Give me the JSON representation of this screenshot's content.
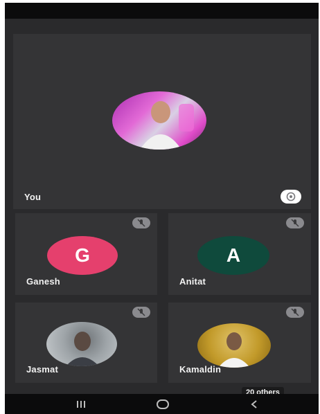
{
  "tiles": {
    "you": {
      "name": "You"
    },
    "p1": {
      "name": "Ganesh",
      "initial": "G"
    },
    "p2": {
      "name": "Anitat",
      "initial": "A"
    },
    "p3": {
      "name": "Jasmat"
    },
    "p4": {
      "name": "Kamaldin",
      "others": "20 others"
    }
  },
  "colors": {
    "background": "#2a2a2c",
    "tile": "#343436",
    "avatar_g": "#e5406d",
    "avatar_a": "#0f4a3c",
    "mute_badge": "#8a8a8e"
  },
  "icons": {
    "mute": "mic-off-icon",
    "speaking": "mic-icon",
    "nav_recents": "recent-apps-icon",
    "nav_home": "home-icon",
    "nav_back": "back-icon"
  }
}
